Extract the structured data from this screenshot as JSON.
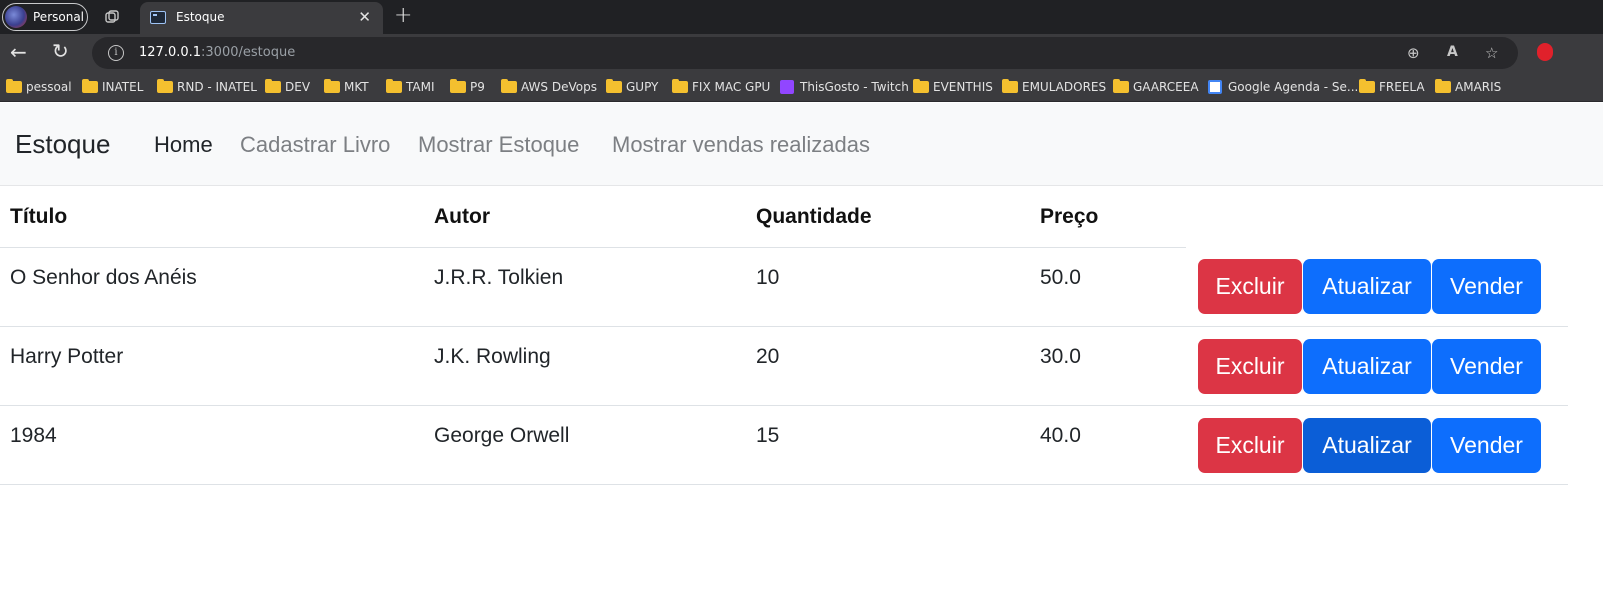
{
  "browser": {
    "profile_label": "Personal",
    "tab_title": "Estoque",
    "url_host": "127.0.0.1",
    "url_rest": ":3000/estoque",
    "bookmarks": [
      {
        "label": "pessoal",
        "icon": "folder-icon"
      },
      {
        "label": "INATEL",
        "icon": "folder-icon"
      },
      {
        "label": "RND - INATEL",
        "icon": "folder-icon"
      },
      {
        "label": "DEV",
        "icon": "folder-icon"
      },
      {
        "label": "MKT",
        "icon": "folder-icon"
      },
      {
        "label": "TAMI",
        "icon": "folder-icon"
      },
      {
        "label": "P9",
        "icon": "folder-icon"
      },
      {
        "label": "AWS DeVops",
        "icon": "folder-icon"
      },
      {
        "label": "GUPY",
        "icon": "folder-icon"
      },
      {
        "label": "FIX MAC GPU",
        "icon": "folder-icon"
      },
      {
        "label": "ThisGosto - Twitch",
        "icon": "twitch-icon"
      },
      {
        "label": "EVENTHIS",
        "icon": "folder-icon"
      },
      {
        "label": "EMULADORES",
        "icon": "folder-icon"
      },
      {
        "label": "GAARCEEA",
        "icon": "folder-icon"
      },
      {
        "label": "Google Agenda - Se...",
        "icon": "google-calendar-icon"
      },
      {
        "label": "FREELA",
        "icon": "folder-icon"
      },
      {
        "label": "AMARIS",
        "icon": "folder-icon"
      }
    ]
  },
  "navbar": {
    "brand": "Estoque",
    "links": [
      {
        "label": "Home",
        "active": true
      },
      {
        "label": "Cadastrar Livro",
        "active": false
      },
      {
        "label": "Mostrar Estoque",
        "active": false
      },
      {
        "label": "Mostrar vendas realizadas",
        "active": false
      }
    ]
  },
  "table": {
    "headers": [
      "Título",
      "Autor",
      "Quantidade",
      "Preço"
    ],
    "rows": [
      {
        "titulo": "O Senhor dos Anéis",
        "autor": "J.R.R. Tolkien",
        "quantidade": "10",
        "preco": "50.0"
      },
      {
        "titulo": "Harry Potter",
        "autor": "J.K. Rowling",
        "quantidade": "20",
        "preco": "30.0"
      },
      {
        "titulo": "1984",
        "autor": "George Orwell",
        "quantidade": "15",
        "preco": "40.0"
      }
    ],
    "actions": {
      "delete": "Excluir",
      "update": "Atualizar",
      "sell": "Vender"
    }
  },
  "colors": {
    "danger": "#dc3545",
    "primary": "#0d6efd",
    "primary_hover": "#0b5ed7",
    "navbar_bg": "#f8f9fa"
  }
}
